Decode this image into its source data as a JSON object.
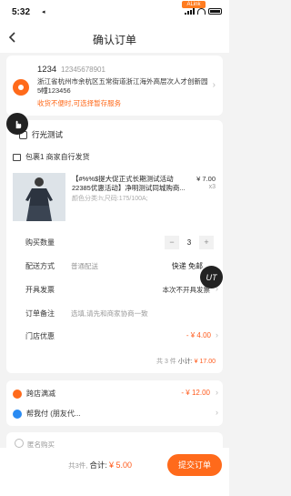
{
  "status_bar": {
    "time": "5:32",
    "arrow": "◂",
    "badge": "ALink"
  },
  "nav": {
    "title": "确认订单"
  },
  "address": {
    "name": "1234",
    "phone": "12345678901",
    "full": "浙江省杭州市余杭区五常街道浙江海外高层次人才创新园5幢123456",
    "notice": "收货不便时,可选择暂存服务"
  },
  "store": {
    "name": "行光测试"
  },
  "package": {
    "label": "包裹1 商家自行发货"
  },
  "product": {
    "title": "【#%%$提大促正式长期测试活动22385优惠活动】净明测试同城购商...",
    "sku": "颜色分类:h;尺码:175/100A;",
    "price": "¥ 7.00",
    "qty": "x3"
  },
  "order_fields": {
    "qty_label": "购买数量",
    "qty_minus": "−",
    "qty_value": "3",
    "qty_plus": "+",
    "ship_label": "配送方式",
    "ship_type": "普通配送",
    "ship_value": "快递 免邮",
    "invoice_label": "开具发票",
    "invoice_value": "本次不开具发票",
    "note_label": "订单备注",
    "note_placeholder": "选填,请先和商家协商一致",
    "discount_label": "门店优惠",
    "discount_value": "- ¥ 4.00",
    "subtotal_prefix": "共 3 件",
    "subtotal_label": " 小计:",
    "subtotal_value": "¥ 17.00"
  },
  "floating": {
    "ut_label": "UT"
  },
  "promos": [
    {
      "label": "跨店满减",
      "value": "- ¥ 12.00"
    },
    {
      "label": "帮我付 (朋友代...",
      "value": ""
    }
  ],
  "anonymous": {
    "label": "匿名购买"
  },
  "footer": {
    "count": "共3件,",
    "total_label": "合计:",
    "total_value": "¥ 5.00",
    "submit": "提交订单"
  },
  "colors": {
    "accent": "#ff6a1b",
    "price": "#ff5a1b",
    "blue": "#2a8bf2"
  }
}
